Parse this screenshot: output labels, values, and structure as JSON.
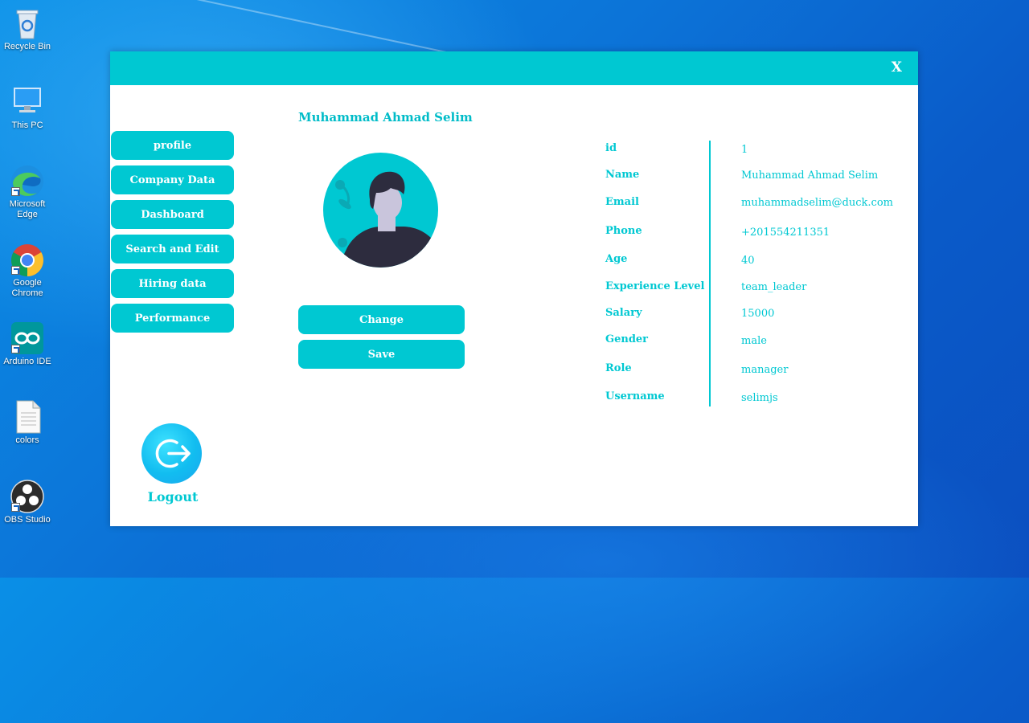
{
  "desktop": {
    "icons": [
      {
        "label": "Recycle Bin",
        "icon": "recycle-bin-icon"
      },
      {
        "label": "This PC",
        "icon": "this-pc-icon"
      },
      {
        "label": "Microsoft Edge",
        "icon": "edge-icon"
      },
      {
        "label": "Google Chrome",
        "icon": "chrome-icon"
      },
      {
        "label": "Arduino IDE",
        "icon": "arduino-icon"
      },
      {
        "label": "colors",
        "icon": "text-file-icon"
      },
      {
        "label": "OBS Studio",
        "icon": "obs-icon"
      }
    ]
  },
  "window": {
    "close_label": "X",
    "nav": [
      {
        "label": "profile"
      },
      {
        "label": "Company Data"
      },
      {
        "label": "Dashboard"
      },
      {
        "label": "Search and Edit"
      },
      {
        "label": "Hiring data"
      },
      {
        "label": "Performance"
      }
    ],
    "user_name": "Muhammad Ahmad Selim",
    "change_label": "Change",
    "save_label": "Save",
    "logout_label": "Logout",
    "fields": [
      {
        "label": "id",
        "value": "1"
      },
      {
        "label": "Name",
        "value": "Muhammad Ahmad Selim"
      },
      {
        "label": "Email",
        "value": "muhammadselim@duck.com"
      },
      {
        "label": "Phone",
        "value": "+201554211351"
      },
      {
        "label": "Age",
        "value": "40"
      },
      {
        "label": "Experience Level",
        "value": "team_leader"
      },
      {
        "label": "Salary",
        "value": "15000"
      },
      {
        "label": "Gender",
        "value": "male"
      },
      {
        "label": "Role",
        "value": "manager"
      },
      {
        "label": "Username",
        "value": "selimjs"
      }
    ]
  },
  "colors": {
    "accent": "#00c8d2",
    "window_bg": "#ffffff",
    "desktop_bg": "#0c74d8"
  }
}
